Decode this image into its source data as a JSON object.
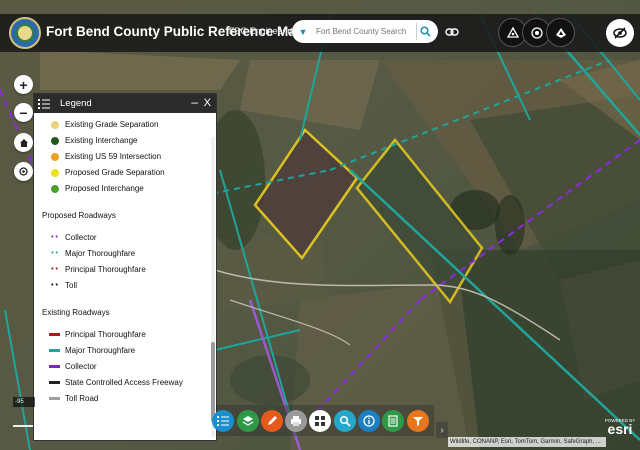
{
  "app": {
    "title": "Fort Bend County Public Reference Map",
    "subtitle": "FBC Engineering GIS"
  },
  "search": {
    "placeholder": "Fort Bend County Search"
  },
  "icons": {
    "logo": "county-seal-icon",
    "search": "search-icon",
    "link": "link-icon",
    "header_tools": [
      "measure-icon",
      "basemap-icon",
      "layer-icon"
    ],
    "toggle": "visibility-off-icon",
    "controls": [
      "zoom-in-icon",
      "zoom-out-icon",
      "home-icon",
      "locate-icon"
    ],
    "toolbar": [
      "legend-icon",
      "layers-icon",
      "edit-icon",
      "print-icon",
      "basemap-gallery-icon",
      "search-icon",
      "info-icon",
      "table-icon",
      "filter-icon"
    ]
  },
  "controls": {
    "zoom_in": "+",
    "zoom_out": "−"
  },
  "legend": {
    "title": "Legend",
    "minimize_label": "–",
    "close_label": "X",
    "point_items": [
      {
        "label": "Existing Grade Separation",
        "color": "#e8d27a"
      },
      {
        "label": "Existing Interchange",
        "color": "#1f5a1f"
      },
      {
        "label": "Existing US 59 Intersection",
        "color": "#f0a020"
      },
      {
        "label": "Proposed Grade Separation",
        "color": "#e9e21c"
      },
      {
        "label": "Proposed Interchange",
        "color": "#4aa02c"
      }
    ],
    "proposed_heading": "Proposed Roadways",
    "proposed_items": [
      {
        "label": "Collector",
        "color": "#8a2be2"
      },
      {
        "label": "Major Thoroughfare",
        "color": "#1fa59a"
      },
      {
        "label": "Principal Thoroughfare",
        "color": "#b01818"
      },
      {
        "label": "Toll",
        "color": "#111111"
      }
    ],
    "existing_heading": "Existing Roadways",
    "existing_items": [
      {
        "label": "Principal Thoroughfare",
        "color": "#b01818"
      },
      {
        "label": "Major Thoroughfare",
        "color": "#1fa59a"
      },
      {
        "label": "Collector",
        "color": "#7a2bb5"
      },
      {
        "label": "State Controlled Access Freeway",
        "color": "#222222"
      },
      {
        "label": "Toll Road",
        "color": "#a0a0a0"
      }
    ]
  },
  "toolbar_colors": [
    "#1a8fd0",
    "#2e9a48",
    "#e45a1c",
    "#9a9a9a",
    "#ffffff",
    "#25a8c9",
    "#1b7fc4",
    "#2e9a48",
    "#e8761c"
  ],
  "attribution": "Wildlife, CONANP, Esri, TomTom, Garmin, SafeGraph, ...",
  "esri": {
    "powered": "POWERED BY",
    "brand": "esri"
  },
  "scale": {
    "label": "-95"
  },
  "next_label": "›",
  "colors": {
    "header_bg": "#191919",
    "parcel_outline": "#f2d51c",
    "major_thoroughfare": "#1fa59a",
    "collector": "#8a2be2"
  }
}
